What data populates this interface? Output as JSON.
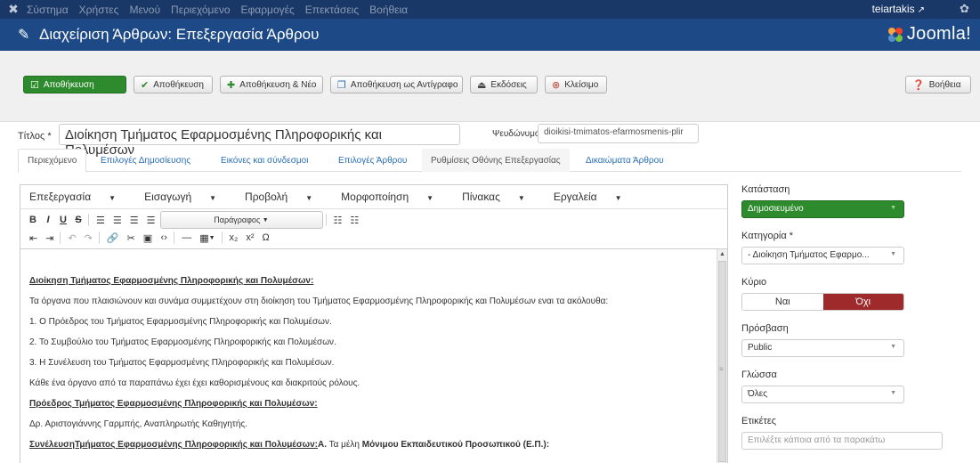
{
  "topbar": {
    "menu": [
      "Σύστημα",
      "Χρήστες",
      "Μενού",
      "Περιεχόμενο",
      "Εφαρμογές",
      "Επεκτάσεις",
      "Βοήθεια"
    ],
    "user": "teiartakis",
    "external_icon": "external-link-icon",
    "gear_icon": "gear-icon"
  },
  "header": {
    "title": "Διαχείριση Άρθρων: Επεξεργασία Άρθρου",
    "brand": "Joomla!"
  },
  "toolbar": {
    "save": "Αποθήκευση",
    "save_close": "Αποθήκευση",
    "save_new": "Αποθήκευση & Νέο",
    "save_copy": "Αποθήκευση ως Αντίγραφο",
    "versions": "Εκδόσεις",
    "close": "Κλείσιμο",
    "help": "Βοήθεια"
  },
  "form": {
    "title_label": "Τίτλος *",
    "title_value": "Διοίκηση Τμήματος Εφαρμοσμένης Πληροφορικής και Πολυμέσων",
    "alias_label": "Ψευδώνυμο",
    "alias_value": "dioikisi-tmimatos-efarmosmenis-plir"
  },
  "tabs": [
    "Περιεχόμενο",
    "Επιλογές Δημοσίευσης",
    "Εικόνες και σύνδεσμοι",
    "Επιλογές Άρθρου",
    "Ρυθμίσεις Οθόνης Επεξεργασίας",
    "Δικαιώματα Άρθρου"
  ],
  "editor": {
    "menus": [
      "Επεξεργασία",
      "Εισαγωγή",
      "Προβολή",
      "Μορφοποίηση",
      "Πίνακας",
      "Εργαλεία"
    ],
    "format_select": "Παράγραφος",
    "body": {
      "p1": "Διοίκηση Τμήματος Εφαρμοσμένης Πληροφορικής και Πολυμέσων:",
      "p2": "Τα όργανα που πλαισιώνουν και συνάμα συμμετέχουν στη διοίκηση του Τμήματος Εφαρμοσμένης Πληροφορικής και Πολυμέσων εναι τα ακόλουθα:",
      "p3": "1. Ο Πρόεδρος του Τμήματος Εφαρμοσμένης Πληροφορικής και Πολυμέσων.",
      "p4": "2.  Το Συμβούλιο του Τμήματος Εφαρμοσμένης Πληροφορικής και Πολυμέσων.",
      "p5": "3. Η Συνέλευση του Τμήματος Εφαρμοσμένης Πληροφορικής και Πολυμέσων.",
      "p6": "Κάθε ένα όργανο από τα παραπάνω έχει έχει καθορισμένους και διακριτούς ρόλους.",
      "p7": "Πρόεδρος Τμήματος Εφαρμοσμένης Πληροφορικής και Πολυμέσων:",
      "p8": "Δρ. Αριστογιάννης Γαρμπής, Αναπληρωτής Καθηγητής.",
      "p9_a": "ΣυνέλευσηΤμήματος Εφαρμοσμένης Πληροφορικής και Πολυμέσων:",
      "p9_b": "Α.",
      "p9_c": " Τα μέλη ",
      "p9_d": "Μόνιμου Εκπαιδευτικού Προσωπικού (Ε.Π.):"
    }
  },
  "sidebar": {
    "status_label": "Κατάσταση",
    "status_value": "Δημοσιευμένο",
    "category_label": "Κατηγορία *",
    "category_value": "- Διοίκηση Τμήματος Εφαρμο...",
    "featured_label": "Κύριο",
    "featured_yes": "Ναι",
    "featured_no": "Όχι",
    "access_label": "Πρόσβαση",
    "access_value": "Public",
    "language_label": "Γλώσσα",
    "language_value": "Όλες",
    "tags_label": "Ετικέτες",
    "tags_placeholder": "Επιλέξτε κάποια από τα παρακάτω"
  },
  "colors": {
    "topbar": "#1a3867",
    "header": "#1d4a87",
    "success": "#2d8b2d",
    "danger": "#9e2a2b",
    "link": "#2a6fb6"
  }
}
